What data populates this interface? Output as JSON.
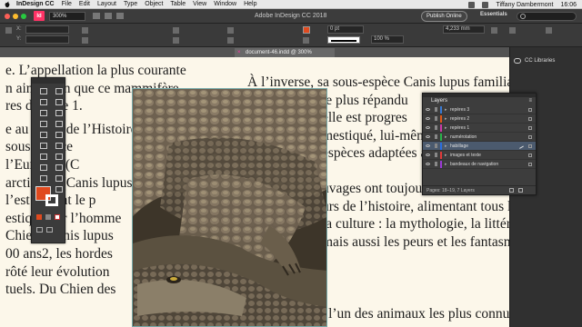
{
  "menubar": {
    "app_name": "InDesign CC",
    "items": [
      "File",
      "Edit",
      "Layout",
      "Type",
      "Object",
      "Table",
      "View",
      "Window",
      "Help"
    ],
    "user": "Tiffany Dambermont",
    "clock": "16:06"
  },
  "appbar": {
    "logo": "Id",
    "zoom": "300%",
    "title": "Adobe InDesign CC 2018",
    "publish_label": "Publish Online",
    "workspace": "Essentials",
    "search_placeholder": ""
  },
  "controlbar": {
    "x_label": "X:",
    "y_label": "Y:",
    "x_value": "",
    "y_value": "",
    "stroke_weight": "0 pt",
    "scale_x": "100 %",
    "scale_y": "100 %",
    "stroke_value": "4,233 mm",
    "fill_color": "#e04a1f"
  },
  "document_tab": {
    "label": "document-46.indd @ 300%"
  },
  "dock": {
    "cc_libraries_label": "CC Libraries"
  },
  "text": {
    "left_lines": [
      "e. L’appellation la plus courante",
      "n ainsi bien que ce mammifère",
      "res désnote 1.",
      "",
      "e au cours de l’Histoire",
      "sous-espèce",
      "l’Europe1 (C",
      "arctique1 (Canis lupus",
      "l’est lement le p",
      "estiqué par l’homme",
      "Chien (Canis lupus",
      "00 ans2, les hordes",
      "rôté leur évolution",
      "tuels. Du Chien des"
    ],
    "right_para1": [
      "À l’inverse, sa sous-espèce Canis lupus familiaris",
      "le plus répandu",
      "elle est progres",
      "mestiqué, lui-même",
      "espèces adaptées aux"
    ],
    "right_para2": [
      "uvages ont toujours fasciné les hu-",
      "urs de l’histoire, alimentant tous les",
      "la culture : la mythologie, la littéra-",
      "mais aussi les peurs et les fantasmes"
    ],
    "right_para3": "est l’un des animaux les plus connus"
  },
  "layers_panel": {
    "tab_label": "Layers",
    "layers": [
      {
        "name": "repères 3",
        "color": "#3a7bd5",
        "selected": false
      },
      {
        "name": "repères 2",
        "color": "#e05a1a",
        "selected": false
      },
      {
        "name": "repères 1",
        "color": "#cc3aa8",
        "selected": false
      },
      {
        "name": "numérotation",
        "color": "#2ab24a",
        "selected": false
      },
      {
        "name": "habillage",
        "color": "#2a6ee0",
        "selected": true
      },
      {
        "name": "images et texte",
        "color": "#e03a3a",
        "selected": false
      },
      {
        "name": "bandeaux de navigation",
        "color": "#9b3ad5",
        "selected": false
      }
    ],
    "footer": "Pages: 18–19, 7 Layers"
  }
}
